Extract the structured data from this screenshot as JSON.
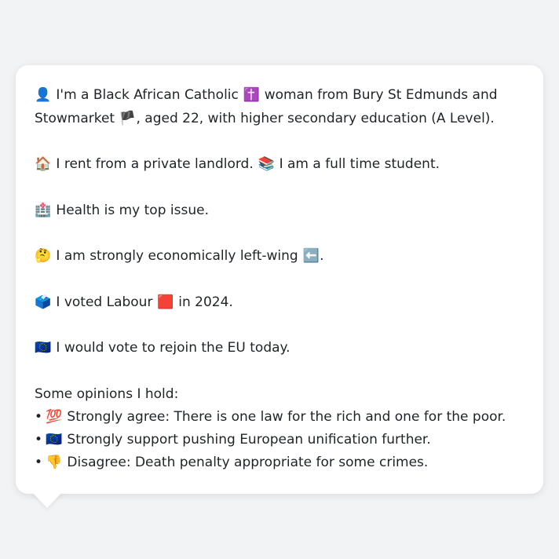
{
  "profile": {
    "identity": {
      "icon": "👤",
      "text_a": "I'm a Black African Catholic",
      "icon2": "✝️",
      "text_b": "woman from Bury St Edmunds and Stowmarket",
      "icon3": "🏴",
      "text_c": ", aged 22, with higher secondary education (A Level)."
    },
    "housing": {
      "icon": "🏠",
      "text_a": "I rent from a private landlord.",
      "icon2": "📚",
      "text_b": "I am a full time student."
    },
    "issue": {
      "icon": "🏥",
      "text": "Health is my top issue."
    },
    "economics": {
      "icon": "🤔",
      "text": "I am strongly economically left-wing",
      "icon2": "⬅️",
      "suffix": "."
    },
    "vote": {
      "icon": "🗳️",
      "text_a": "I voted Labour",
      "icon2": "🟥",
      "text_b": "in 2024."
    },
    "eu": {
      "icon": "🇪🇺",
      "text": "I would vote to rejoin the EU today."
    }
  },
  "opinions": {
    "title": "Some opinions I hold:",
    "bullet": "•",
    "items": [
      {
        "icon": "💯",
        "text": "Strongly agree: There is one law for the rich and one for the poor."
      },
      {
        "icon": "🇪🇺",
        "text": "Strongly support pushing European unification further."
      },
      {
        "icon": "👎",
        "text": "Disagree: Death penalty appropriate for some crimes."
      }
    ]
  }
}
